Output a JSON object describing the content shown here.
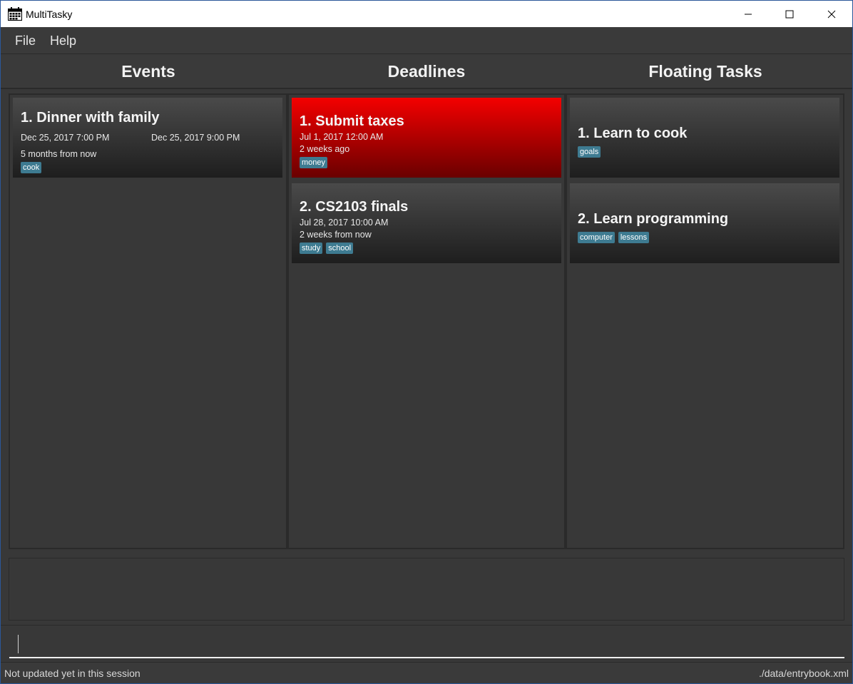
{
  "window": {
    "title": "MultiTasky",
    "icon": "calendar-icon"
  },
  "menu": {
    "file": "File",
    "help": "Help"
  },
  "columns": {
    "events": "Events",
    "deadlines": "Deadlines",
    "floating": "Floating Tasks"
  },
  "events": [
    {
      "title": "1.  Dinner with family",
      "start": "Dec 25, 2017 7:00 PM",
      "end": "Dec 25, 2017 9:00 PM",
      "relative": "5 months from now",
      "tags": [
        "cook"
      ]
    }
  ],
  "deadlines": [
    {
      "title": "1.  Submit taxes",
      "date": "Jul 1, 2017 12:00 AM",
      "relative": "2 weeks ago",
      "tags": [
        "money"
      ],
      "overdue": true
    },
    {
      "title": "2.  CS2103 finals",
      "date": "Jul 28, 2017 10:00 AM",
      "relative": "2 weeks from now",
      "tags": [
        "study",
        "school"
      ],
      "overdue": false
    }
  ],
  "floating": [
    {
      "title": "1.  Learn to cook",
      "tags": [
        "goals"
      ]
    },
    {
      "title": "2.  Learn programming",
      "tags": [
        "computer",
        "lessons"
      ]
    }
  ],
  "command": {
    "value": ""
  },
  "status": {
    "left": "Not updated yet in this session",
    "right": "./data/entrybook.xml"
  },
  "colors": {
    "overdue": "#f40000",
    "tag": "#3e7b91",
    "background": "#383838"
  }
}
